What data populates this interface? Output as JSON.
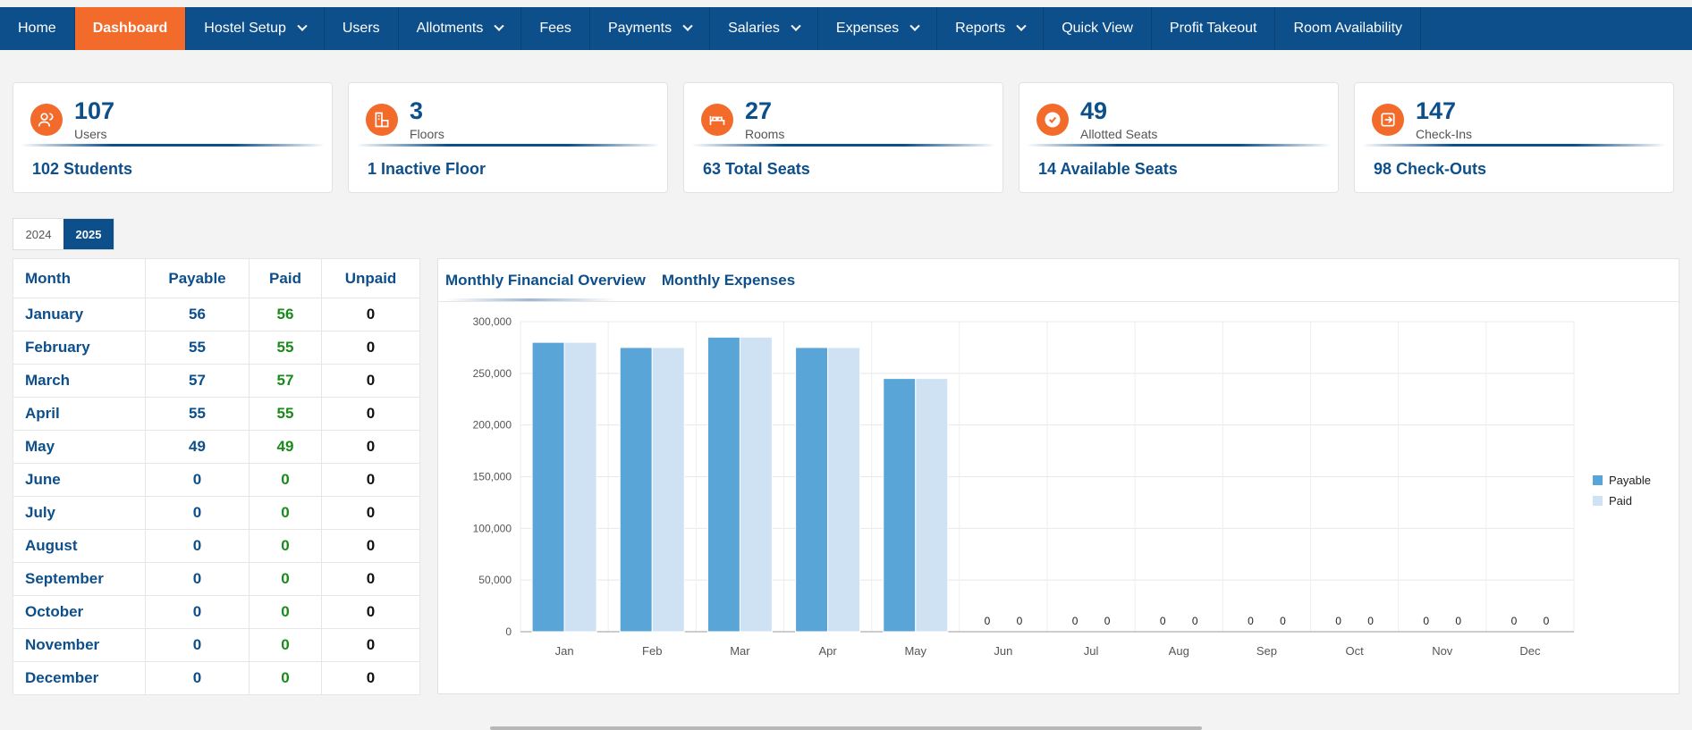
{
  "nav": {
    "items": [
      {
        "label": "Home",
        "dropdown": false,
        "active": false
      },
      {
        "label": "Dashboard",
        "dropdown": false,
        "active": true
      },
      {
        "label": "Hostel Setup",
        "dropdown": true,
        "active": false
      },
      {
        "label": "Users",
        "dropdown": false,
        "active": false
      },
      {
        "label": "Allotments",
        "dropdown": true,
        "active": false
      },
      {
        "label": "Fees",
        "dropdown": false,
        "active": false
      },
      {
        "label": "Payments",
        "dropdown": true,
        "active": false
      },
      {
        "label": "Salaries",
        "dropdown": true,
        "active": false
      },
      {
        "label": "Expenses",
        "dropdown": true,
        "active": false
      },
      {
        "label": "Reports",
        "dropdown": true,
        "active": false
      },
      {
        "label": "Quick View",
        "dropdown": false,
        "active": false
      },
      {
        "label": "Profit Takeout",
        "dropdown": false,
        "active": false
      },
      {
        "label": "Room Availability",
        "dropdown": false,
        "active": false
      }
    ]
  },
  "cards": [
    {
      "icon": "users-icon",
      "value": "107",
      "label": "Users",
      "sub": "102 Students"
    },
    {
      "icon": "floors-icon",
      "value": "3",
      "label": "Floors",
      "sub": "1 Inactive Floor"
    },
    {
      "icon": "bed-icon",
      "value": "27",
      "label": "Rooms",
      "sub": "63 Total Seats"
    },
    {
      "icon": "check-circle-icon",
      "value": "49",
      "label": "Allotted Seats",
      "sub": "14 Available Seats"
    },
    {
      "icon": "check-in-icon",
      "value": "147",
      "label": "Check-Ins",
      "sub": "98 Check-Outs"
    }
  ],
  "years": {
    "items": [
      "2024",
      "2025"
    ],
    "selected": "2025"
  },
  "table": {
    "headers": {
      "month": "Month",
      "payable": "Payable",
      "paid": "Paid",
      "unpaid": "Unpaid"
    },
    "rows": [
      {
        "month": "January",
        "payable": "56",
        "paid": "56",
        "unpaid": "0"
      },
      {
        "month": "February",
        "payable": "55",
        "paid": "55",
        "unpaid": "0"
      },
      {
        "month": "March",
        "payable": "57",
        "paid": "57",
        "unpaid": "0"
      },
      {
        "month": "April",
        "payable": "55",
        "paid": "55",
        "unpaid": "0"
      },
      {
        "month": "May",
        "payable": "49",
        "paid": "49",
        "unpaid": "0"
      },
      {
        "month": "June",
        "payable": "0",
        "paid": "0",
        "unpaid": "0"
      },
      {
        "month": "July",
        "payable": "0",
        "paid": "0",
        "unpaid": "0"
      },
      {
        "month": "August",
        "payable": "0",
        "paid": "0",
        "unpaid": "0"
      },
      {
        "month": "September",
        "payable": "0",
        "paid": "0",
        "unpaid": "0"
      },
      {
        "month": "October",
        "payable": "0",
        "paid": "0",
        "unpaid": "0"
      },
      {
        "month": "November",
        "payable": "0",
        "paid": "0",
        "unpaid": "0"
      },
      {
        "month": "December",
        "payable": "0",
        "paid": "0",
        "unpaid": "0"
      }
    ]
  },
  "panel": {
    "tabs": [
      "Monthly Financial Overview",
      "Monthly Expenses"
    ],
    "active_tab": "Monthly Financial Overview"
  },
  "colors": {
    "nav": "#0d4f8b",
    "accent": "#f26b2a",
    "payable": "#5aa5d8",
    "paid": "#cfe2f3"
  },
  "chart_data": {
    "type": "bar",
    "categories": [
      "Jan",
      "Feb",
      "Mar",
      "Apr",
      "May",
      "Jun",
      "Jul",
      "Aug",
      "Sep",
      "Oct",
      "Nov",
      "Dec"
    ],
    "series": [
      {
        "name": "Payable",
        "values": [
          280000,
          275000,
          285000,
          275000,
          245000,
          0,
          0,
          0,
          0,
          0,
          0,
          0
        ]
      },
      {
        "name": "Paid",
        "values": [
          280000,
          275000,
          285000,
          275000,
          245000,
          0,
          0,
          0,
          0,
          0,
          0,
          0
        ]
      }
    ],
    "yticks": [
      0,
      50000,
      100000,
      150000,
      200000,
      250000,
      300000
    ],
    "ytick_labels": [
      "0",
      "50,000",
      "100,000",
      "150,000",
      "200,000",
      "250,000",
      "300,000"
    ],
    "ylim": [
      0,
      300000
    ],
    "grid": true,
    "legend_position": "right",
    "zero_labels": true
  }
}
